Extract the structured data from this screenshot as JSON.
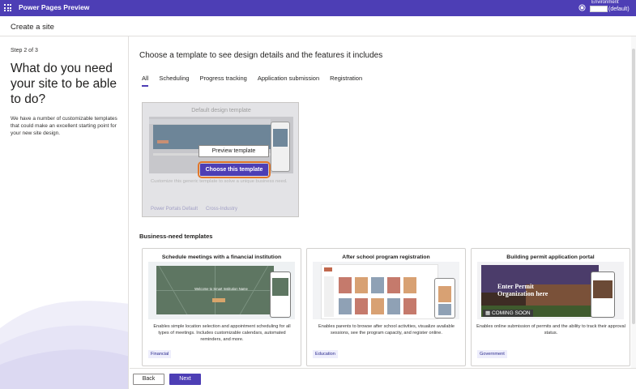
{
  "topbar": {
    "app_title": "Power Pages Preview",
    "environment_label": "Environment",
    "environment_suffix": "(default)",
    "background": "#4d3eb5"
  },
  "header": {
    "title": "Create a site"
  },
  "left": {
    "step": "Step 2 of 3",
    "heading": "What do you need your site to be able to do?",
    "description": "We have a number of customizable templates that could make an excellent starting point for your new site design."
  },
  "main": {
    "title": "Choose a template to see design details and the features it includes",
    "tabs": [
      {
        "label": "All",
        "active": true
      },
      {
        "label": "Scheduling",
        "active": false
      },
      {
        "label": "Progress tracking",
        "active": false
      },
      {
        "label": "Application submission",
        "active": false
      },
      {
        "label": "Registration",
        "active": false
      }
    ],
    "default_template": {
      "title": "Default design template",
      "preview_button": "Preview template",
      "choose_button": "Choose this template",
      "description": "Customize this generic template to solve a unique business need.",
      "tags": [
        "Power Portals Default",
        "Cross-Industry"
      ]
    },
    "business_section_title": "Business-need templates",
    "cards": [
      {
        "title": "Schedule meetings with a financial institution",
        "hero_text": "Welcome to Smart Institution Name",
        "description": "Enables simple location selection and appointment scheduling for all types of meetings. Includes customizable calendars, automated reminders, and more.",
        "tag": "Financial"
      },
      {
        "title": "After school program registration",
        "description": "Enables parents to browse after school activities, visualize available sessions, see the program capacity, and register online.",
        "tag": "Education"
      },
      {
        "title": "Building permit application portal",
        "hero_text": "Enter Permit Organization here",
        "badge": "COMING SOON",
        "description": "Enables online submission of permits and the ability to track their approval status.",
        "tag": "Government"
      }
    ]
  },
  "footer": {
    "back_label": "Back",
    "next_label": "Next"
  },
  "colors": {
    "accent": "#4d3eb5",
    "highlight_ring": "#e2772a"
  }
}
